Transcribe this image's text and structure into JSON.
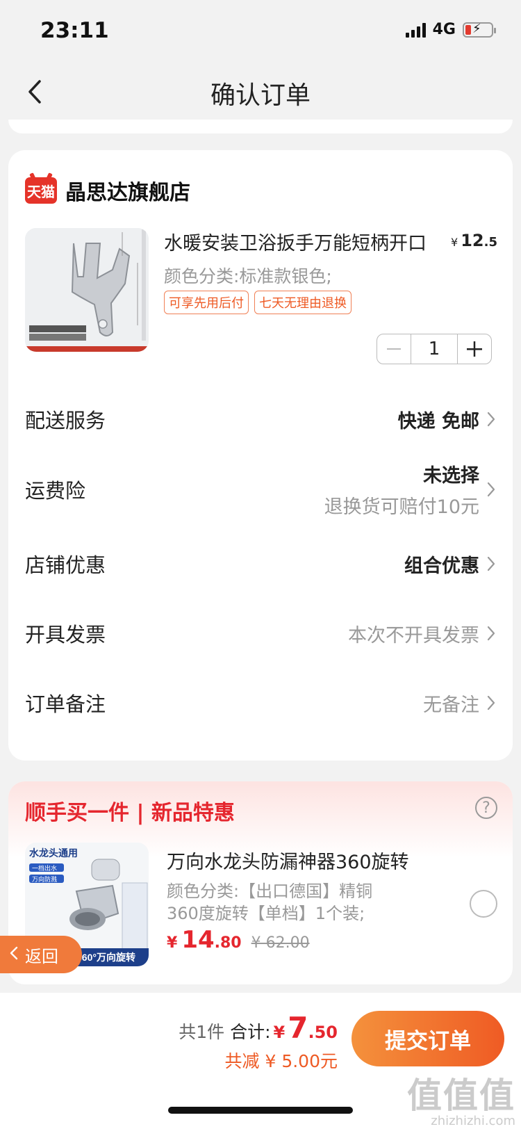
{
  "status_bar": {
    "time": "23:11",
    "network": "4G"
  },
  "header": {
    "title": "确认订单"
  },
  "store": {
    "badge": "天猫",
    "name": "晶思达旗舰店",
    "product": {
      "title": "水暖安装卫浴扳手万能短柄开口",
      "price_currency": "¥",
      "price_int": "12",
      "price_dec": ".5",
      "sku": "颜色分类:标准款银色;",
      "tags": [
        "可享先用后付",
        "七天无理由退换"
      ],
      "quantity": "1"
    }
  },
  "rows": {
    "delivery": {
      "label": "配送服务",
      "value": "快递 免邮"
    },
    "insurance": {
      "label": "运费险",
      "value": "未选择",
      "sub": "退换货可赔付10元"
    },
    "discount": {
      "label": "店铺优惠",
      "value": "组合优惠"
    },
    "invoice": {
      "label": "开具发票",
      "value": "本次不开具发票"
    },
    "note": {
      "label": "订单备注",
      "value": "无备注"
    }
  },
  "promo": {
    "title": "顺手买一件 | 新品特惠",
    "help": "?",
    "product": {
      "name": "万向水龙头防漏神器360旋转",
      "sku_line1": "颜色分类:【出口德国】精铜",
      "sku_line2": "360度旋转【单档】1个装;",
      "price_currency": "¥",
      "price_int": "14",
      "price_dec": ".80",
      "old_price": "¥ 62.00",
      "image_text_title": "水龙头通用",
      "image_text_tag1": "一档出水",
      "image_text_tag2": "万向防溅",
      "image_text_bottom": "360°万向旋转"
    }
  },
  "float_back": {
    "label": "返回"
  },
  "footer": {
    "count_text": "共1件",
    "total_label": "合计:",
    "total_currency": "¥",
    "total_int": "7",
    "total_dec": ".50",
    "discount_text": "共减 ¥ 5.00元",
    "submit_label": "提交订单"
  },
  "watermark": {
    "big": "值值值",
    "small": "zhizhizhi.com"
  },
  "colors": {
    "accent_red": "#e5262e",
    "accent_orange": "#ef5b24",
    "tmall_red": "#e53329"
  }
}
